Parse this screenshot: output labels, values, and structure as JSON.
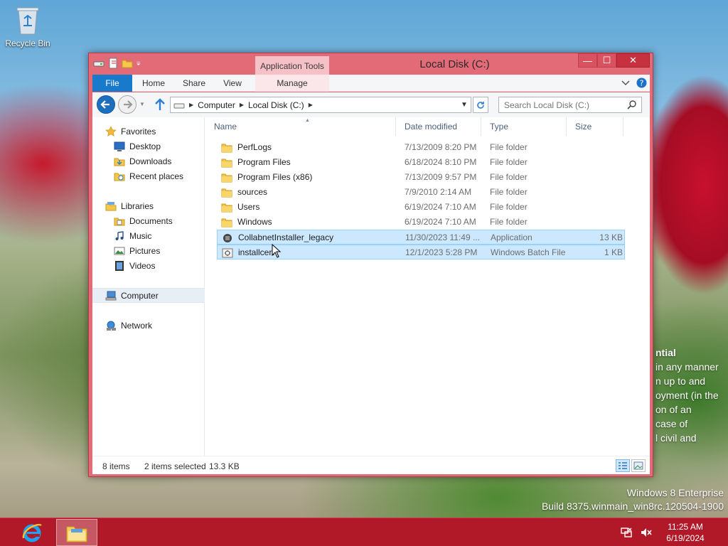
{
  "desktop": {
    "recycle_bin_label": "Recycle Bin",
    "bg_text_lines": [
      "ntial",
      "in any manner",
      "n up to and",
      "oyment (in the",
      "on of an",
      "case of",
      "l civil and"
    ],
    "watermark_line1": "Windows 8 Enterprise",
    "watermark_line2": "Build 8375.winmain_win8rc.120504-1900"
  },
  "window": {
    "title": "Local Disk (C:)",
    "app_tools_label": "Application Tools",
    "caption": {
      "minimize": "—",
      "maximize": "☐",
      "close": "✕"
    }
  },
  "ribbon": {
    "tabs": [
      "File",
      "Home",
      "Share",
      "View",
      "Manage"
    ]
  },
  "address": {
    "crumbs": [
      "Computer",
      "Local Disk (C:)"
    ],
    "search_placeholder": "Search Local Disk (C:)"
  },
  "nav_pane": {
    "favorites": "Favorites",
    "favorites_items": [
      "Desktop",
      "Downloads",
      "Recent places"
    ],
    "libraries": "Libraries",
    "libraries_items": [
      "Documents",
      "Music",
      "Pictures",
      "Videos"
    ],
    "computer": "Computer",
    "network": "Network"
  },
  "columns": [
    "Name",
    "Date modified",
    "Type",
    "Size"
  ],
  "files": [
    {
      "name": "PerfLogs",
      "date": "7/13/2009 8:20 PM",
      "type": "File folder",
      "size": "",
      "icon": "folder-icon",
      "selected": false
    },
    {
      "name": "Program Files",
      "date": "6/18/2024 8:10 PM",
      "type": "File folder",
      "size": "",
      "icon": "folder-icon",
      "selected": false
    },
    {
      "name": "Program Files (x86)",
      "date": "7/13/2009 9:57 PM",
      "type": "File folder",
      "size": "",
      "icon": "folder-icon",
      "selected": false
    },
    {
      "name": "sources",
      "date": "7/9/2010 2:14 AM",
      "type": "File folder",
      "size": "",
      "icon": "folder-icon",
      "selected": false
    },
    {
      "name": "Users",
      "date": "6/19/2024 7:10 AM",
      "type": "File folder",
      "size": "",
      "icon": "folder-icon",
      "selected": false
    },
    {
      "name": "Windows",
      "date": "6/19/2024 7:10 AM",
      "type": "File folder",
      "size": "",
      "icon": "folder-icon",
      "selected": false
    },
    {
      "name": "CollabnetInstaller_legacy",
      "date": "11/30/2023 11:49 ...",
      "type": "Application",
      "size": "13 KB",
      "icon": "application-icon",
      "selected": true
    },
    {
      "name": "installcert",
      "date": "12/1/2023 5:28 PM",
      "type": "Windows Batch File",
      "size": "1 KB",
      "icon": "batch-file-icon",
      "selected": true
    }
  ],
  "status": {
    "item_count": "8 items",
    "selection": "2 items selected",
    "selection_size": "13.3 KB"
  },
  "taskbar": {
    "time": "11:25 AM",
    "date": "6/19/2024"
  },
  "colors": {
    "window_frame": "#e36b78",
    "file_tab": "#1979ca",
    "selection": "#cce8ff",
    "taskbar": "#b11828"
  }
}
